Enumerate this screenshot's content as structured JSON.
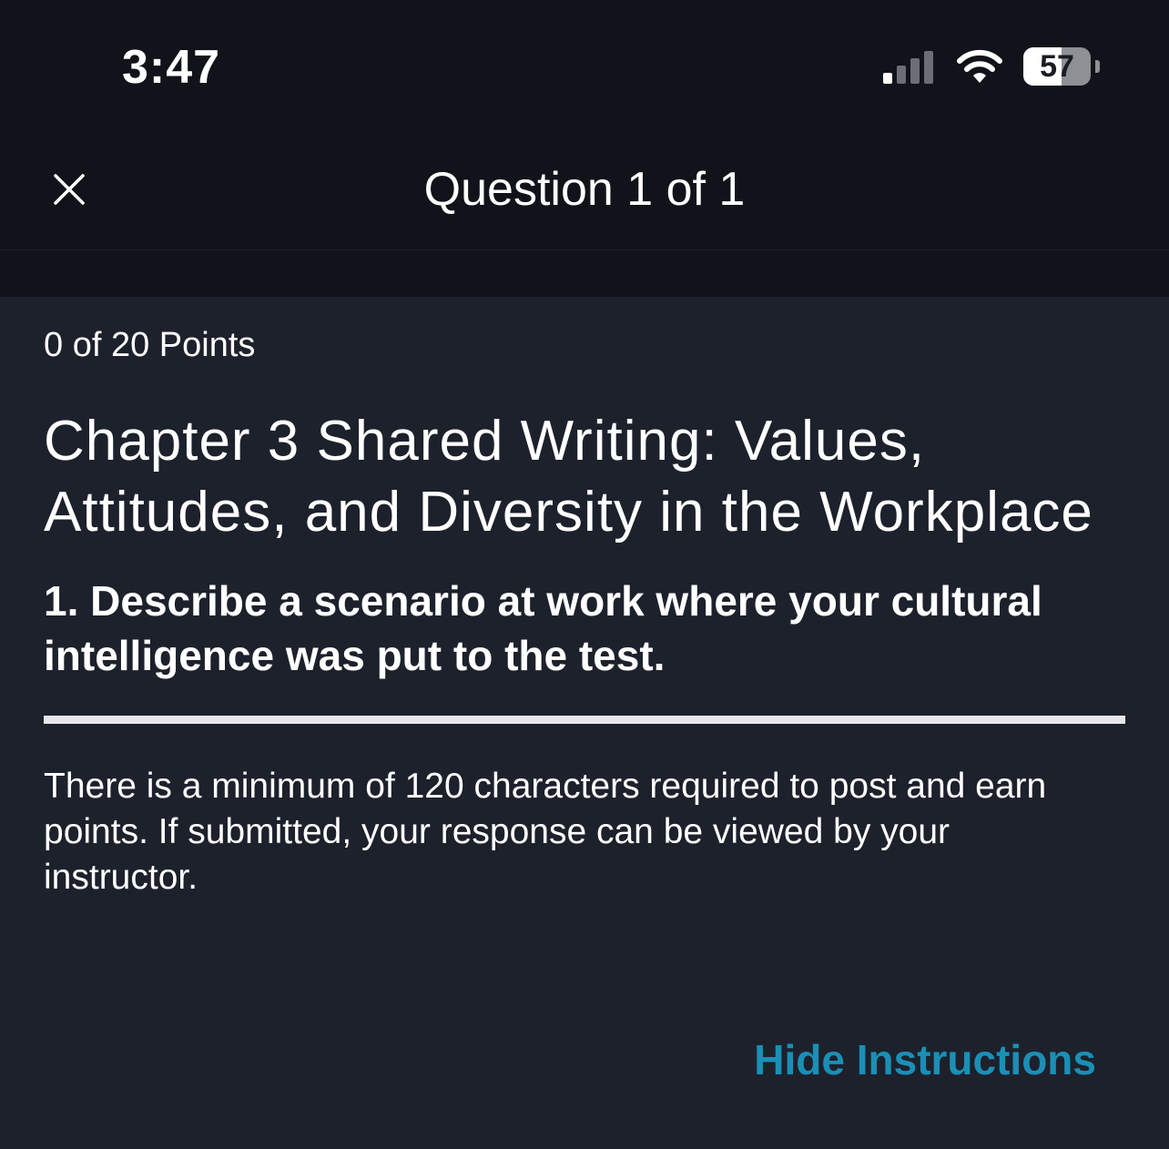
{
  "status_bar": {
    "time": "3:47",
    "battery_percent": 57,
    "battery_label": "57"
  },
  "nav": {
    "title": "Question 1 of 1"
  },
  "content": {
    "points": "0 of 20 Points",
    "chapter_title": "Chapter 3 Shared Writing: Values, Attitudes, and Diversity in the Workplace",
    "question": "1. Describe a scenario at work where your cultural intelligence was put to the test.",
    "instructions": "There is a minimum of 120 characters required to post and earn points. If submitted, your response can be viewed by your instructor.",
    "hide_instructions_label": "Hide Instructions"
  },
  "colors": {
    "background": "#1d212c",
    "header": "#10131a",
    "link": "#1b8fb6"
  }
}
